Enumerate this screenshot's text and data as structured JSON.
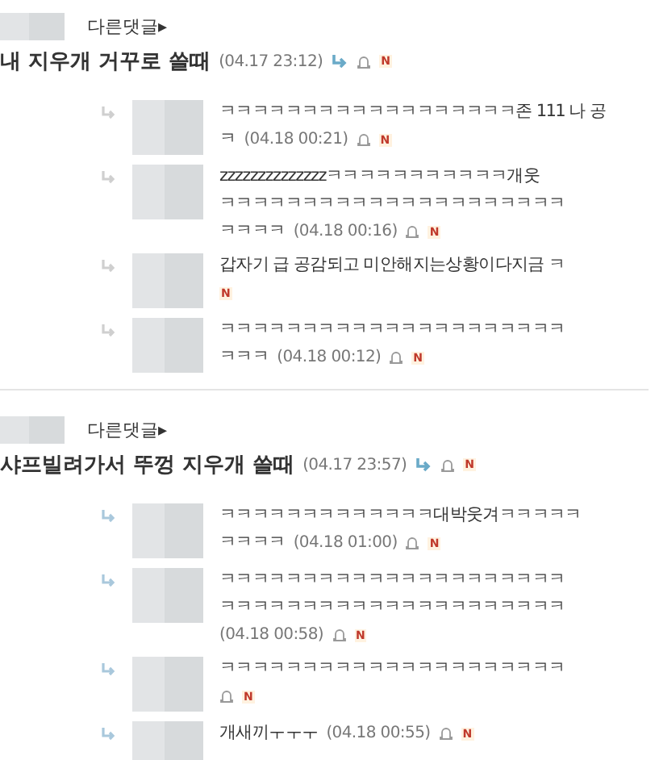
{
  "threads": [
    {
      "more_link": "다른댓글▸",
      "comment": {
        "text": "내 지우개 거꾸로 쓸때",
        "time": "(04.17 23:12)",
        "badge": "N"
      },
      "replies": [
        {
          "lines": [
            "ㅋㅋㅋㅋㅋㅋㅋㅋㅋㅋㅋㅋㅋㅋㅋㅋㅋㅋ존 111 나 공"
          ],
          "tail": "ㅋ",
          "time": "(04.18 00:21)",
          "bell": true,
          "badge": "N"
        },
        {
          "lines": [
            "zzzzzzzzzzzzzzㅋㅋㅋㅋㅋㅋㅋㅋㅋㅋㅋ개웃",
            "ㅋㅋㅋㅋㅋㅋㅋㅋㅋㅋㅋㅋㅋㅋㅋㅋㅋㅋㅋㅋㅋ"
          ],
          "tail": "ㅋㅋㅋㅋ",
          "time": "(04.18 00:16)",
          "bell": true,
          "badge": "N"
        },
        {
          "lines": [
            "갑자기 급 공감되고 미안해지는상황이다지금 ㅋ"
          ],
          "bell": false,
          "badge": "N"
        },
        {
          "lines": [
            "ㅋㅋㅋㅋㅋㅋㅋㅋㅋㅋㅋㅋㅋㅋㅋㅋㅋㅋㅋㅋㅋ"
          ],
          "tail": "ㅋㅋㅋ",
          "time": "(04.18 00:12)",
          "bell": true,
          "badge": "N"
        }
      ]
    },
    {
      "more_link": "다른댓글▸",
      "comment": {
        "text": "샤프빌려가서 뚜껑 지우개 쓸때",
        "time": "(04.17 23:57)",
        "badge": "N"
      },
      "replies": [
        {
          "lines": [
            "ㅋㅋㅋㅋㅋㅋㅋㅋㅋㅋㅋㅋㅋ대박웃겨ㅋㅋㅋㅋㅋ"
          ],
          "tail": "ㅋㅋㅋㅋ",
          "time": "(04.18 01:00)",
          "bell": true,
          "badge": "N"
        },
        {
          "lines": [
            "ㅋㅋㅋㅋㅋㅋㅋㅋㅋㅋㅋㅋㅋㅋㅋㅋㅋㅋㅋㅋㅋ",
            "ㅋㅋㅋㅋㅋㅋㅋㅋㅋㅋㅋㅋㅋㅋㅋㅋㅋㅋㅋㅋㅋ"
          ],
          "time": "(04.18 00:58)",
          "bell": true,
          "badge": "N"
        },
        {
          "lines": [
            "ㅋㅋㅋㅋㅋㅋㅋㅋㅋㅋㅋㅋㅋㅋㅋㅋㅋㅋㅋㅋㅋ"
          ],
          "bell": true,
          "badge": "N"
        },
        {
          "tail": "개새끼ㅜㅜㅜ",
          "time": "(04.18 00:55)",
          "bell": true,
          "badge": "N"
        }
      ]
    }
  ]
}
